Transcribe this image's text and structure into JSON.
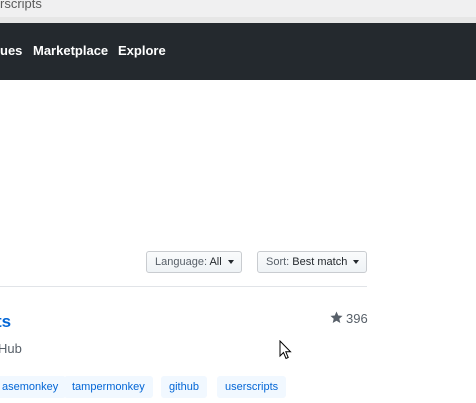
{
  "browser": {
    "url_fragment": "rscripts"
  },
  "nav": {
    "items": [
      "ues",
      "Marketplace",
      "Explore"
    ]
  },
  "filters": {
    "language_label": "Language:",
    "language_value": "All",
    "sort_label": "Sort:",
    "sort_value": "Best match"
  },
  "result": {
    "title": "ts",
    "description": "Hub",
    "stars": "396",
    "topics": [
      "asemonkey",
      "tampermonkey",
      "github",
      "userscripts"
    ]
  },
  "colors": {
    "header_bg": "#24292e",
    "link": "#0366d6",
    "topic_bg": "#f1f8ff"
  },
  "icons": {
    "star": "star-icon",
    "caret": "caret-down-icon",
    "cursor": "mouse-pointer-icon"
  }
}
